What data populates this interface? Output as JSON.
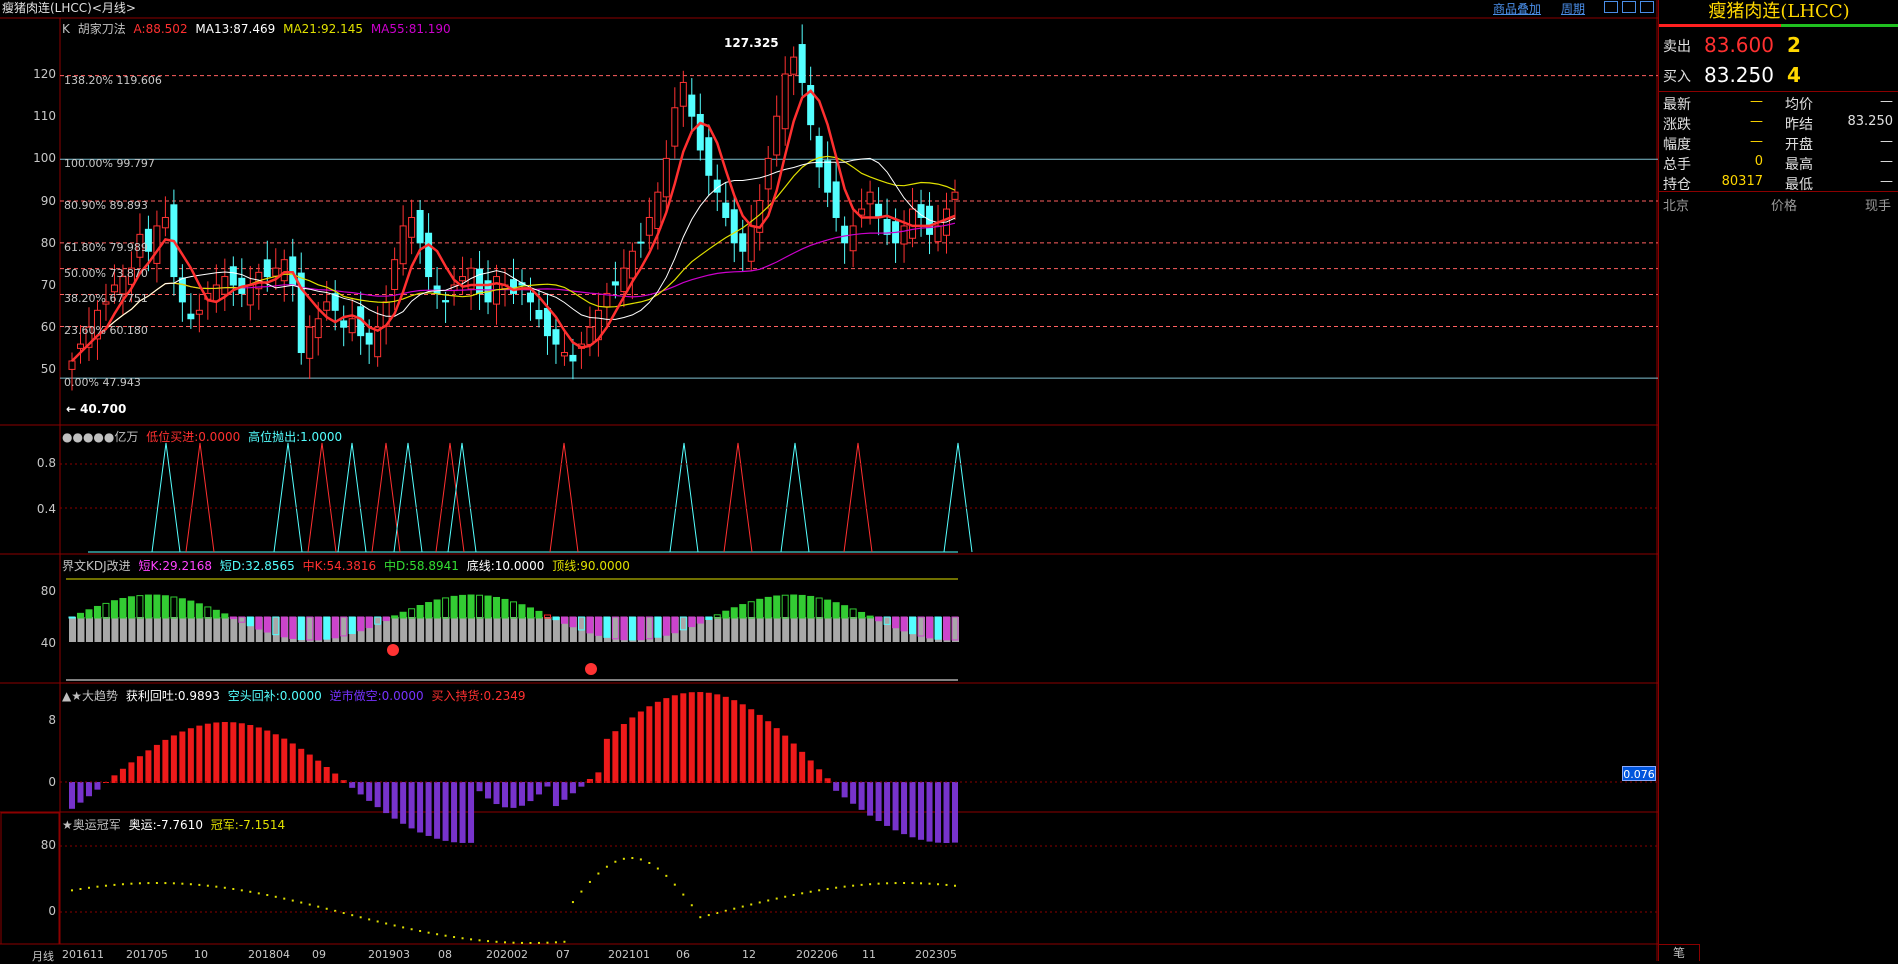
{
  "window": {
    "title": "瘦猪肉连(LHCC)<月线>",
    "overlay_button": "商品叠加",
    "period_button": "周期"
  },
  "main_chart": {
    "indicator_name": "K",
    "formula_name": "胡家刀法",
    "a_label": "A:88.502",
    "ma13_label": "MA13:87.469",
    "ma21_label": "MA21:92.145",
    "ma55_label": "MA55:81.190",
    "high_marker": "127.325",
    "low_marker": "40.700",
    "y_ticks": [
      "120",
      "110",
      "100",
      "90",
      "80",
      "70",
      "60",
      "50"
    ],
    "fib_levels": [
      {
        "text": "138.20% 119.606",
        "value": 119.606
      },
      {
        "text": "100.00% 99.797",
        "value": 99.797
      },
      {
        "text": "80.90% 89.893",
        "value": 89.893
      },
      {
        "text": "61.80% 79.989",
        "value": 79.989
      },
      {
        "text": "50.00% 73.870",
        "value": 73.87
      },
      {
        "text": "38.20% 67.751",
        "value": 67.751
      },
      {
        "text": "23.60% 60.180",
        "value": 60.18
      },
      {
        "text": "0.00% 47.943",
        "value": 47.943
      }
    ],
    "colors": {
      "up": "#ff3232",
      "down": "#54ffff",
      "a_line": "#ff3030",
      "ma13": "#ffffff",
      "ma21": "#e0e000",
      "ma55": "#cc00cc",
      "fib": "#ff6060"
    }
  },
  "panel_yiwan": {
    "title": "●●●●●亿万",
    "low_buy": "低位买进:0.0000",
    "high_sell": "高位抛出:1.0000",
    "y_ticks": [
      "0.8",
      "0.4"
    ]
  },
  "panel_kdj": {
    "title": "界文KDJ改进",
    "short_k": "短K:29.2168",
    "short_d": "短D:32.8565",
    "mid_k": "中K:54.3816",
    "mid_d": "中D:58.8941",
    "bottom_line": "底线:10.0000",
    "top_line": "顶线:90.0000",
    "y_ticks": [
      "80",
      "40"
    ]
  },
  "panel_trend": {
    "title": "▲★大趋势",
    "profit": "获利回吐:0.9893",
    "cover": "空头回补:0.0000",
    "short_sell": "逆市做空:0.0000",
    "buy_hold": "买入持货:0.2349",
    "y_ticks": [
      "8",
      "0"
    ],
    "value_badge": "0.076"
  },
  "panel_olympic": {
    "title": "★奥运冠军",
    "ao": "奥运:-7.7610",
    "champ": "冠军:-7.1514",
    "y_ticks": [
      "80",
      "0"
    ]
  },
  "x_axis": {
    "period": "月线",
    "labels": [
      "201611",
      "201705",
      "10",
      "201804",
      "09",
      "201903",
      "08",
      "202002",
      "07",
      "202101",
      "06",
      "12",
      "202206",
      "11",
      "202305"
    ]
  },
  "quote_panel": {
    "name": "瘦猪肉连(LHCC)",
    "sell_label": "卖出",
    "sell_price": "83.600",
    "sell_qty": "2",
    "buy_label": "买入",
    "buy_price": "83.250",
    "buy_qty": "4",
    "fields": [
      {
        "label": "最新",
        "value": "—",
        "label2": "均价",
        "value2": "—"
      },
      {
        "label": "涨跌",
        "value": "—",
        "label2": "昨结",
        "value2": "83.250"
      },
      {
        "label": "幅度",
        "value": "—",
        "label2": "开盘",
        "value2": "—"
      },
      {
        "label": "总手",
        "value": "0",
        "label2": "最高",
        "value2": "—"
      },
      {
        "label": "持仓",
        "value": "80317",
        "label2": "最低",
        "value2": "—"
      }
    ],
    "trade_header": {
      "time": "北京",
      "price": "价格",
      "qty": "现手"
    },
    "bottom_tab": "笔"
  }
}
